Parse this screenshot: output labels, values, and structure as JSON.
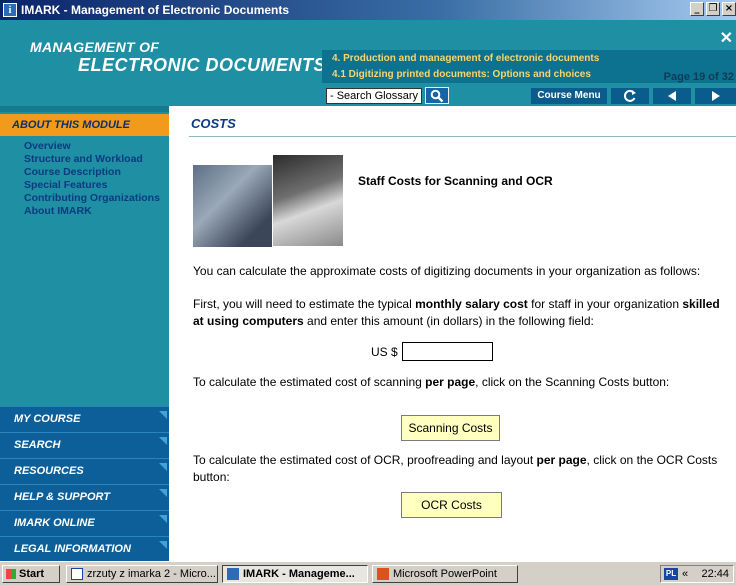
{
  "window": {
    "title": "IMARK  - Management of Electronic Documents",
    "minimize": "_",
    "restore": "❐",
    "close": "×"
  },
  "header": {
    "title_line1": "MANAGEMENT OF",
    "title_line2": "ELECTRONIC DOCUMENTS",
    "chapter_line1": "4.   Production and management of electronic documents",
    "chapter_line2": "4.1  Digitizing printed documents: Options and choices",
    "page_indicator": "Page 19 of 32",
    "close": "✕",
    "search_glossary": "- Search Glossary -",
    "course_menu": "Course Menu"
  },
  "sidebar": {
    "module_header": "ABOUT THIS MODULE",
    "items": [
      {
        "label": "Overview"
      },
      {
        "label": "Structure and Workload"
      },
      {
        "label": "Course Description"
      },
      {
        "label": "Special Features"
      },
      {
        "label": "Contributing Organizations"
      },
      {
        "label": "About IMARK"
      }
    ],
    "bottom_menu": [
      {
        "label": "MY COURSE"
      },
      {
        "label": "SEARCH"
      },
      {
        "label": "RESOURCES"
      },
      {
        "label": "HELP & SUPPORT"
      },
      {
        "label": "IMARK ONLINE"
      },
      {
        "label": "LEGAL INFORMATION"
      }
    ]
  },
  "main": {
    "heading": "COSTS",
    "staff_title": "Staff Costs for Scanning and OCR",
    "intro": "You can calculate the approximate costs of digitizing documents in your organization as follows:",
    "salary_pre": "First, you will need to estimate the typical ",
    "salary_bold1": "monthly salary cost",
    "salary_mid": " for staff in your organization ",
    "salary_bold2": "skilled at using computers",
    "salary_post": " and enter this amount (in dollars) in the following field:",
    "us_label": "US $",
    "us_value": "",
    "scan_pre": "To calculate the estimated cost of scanning ",
    "scan_bold": "per page",
    "scan_post": ", click on the Scanning Costs button:",
    "scan_button": "Scanning Costs",
    "ocr_pre": "To calculate the estimated cost of OCR, proofreading and layout ",
    "ocr_bold": "per page",
    "ocr_post": ", click on the OCR Costs button:",
    "ocr_button": "OCR Costs"
  },
  "taskbar": {
    "start": "Start",
    "items": [
      {
        "label": "zrzuty z imarka 2 - Micro..."
      },
      {
        "label": "IMARK  - Manageme..."
      },
      {
        "label": "Microsoft PowerPoint"
      }
    ],
    "lang": "PL",
    "chevron": "«",
    "clock": "22:44"
  },
  "colors": {
    "header_teal": "#1f8fa4",
    "orange_tab": "#f29a1b",
    "navy_text": "#0b3b80",
    "button_yellow": "#ffffc0"
  }
}
